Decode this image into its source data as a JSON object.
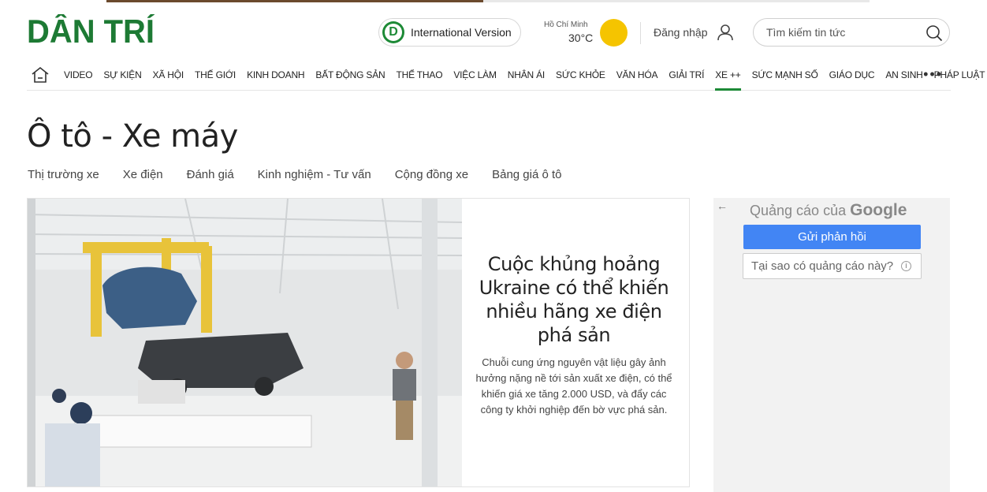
{
  "header": {
    "logo_text": "DÂN TRÍ",
    "international_label": "International Version",
    "weather": {
      "city": "Hồ Chí Minh",
      "temp": "30°C"
    },
    "login_label": "Đăng nhập",
    "search_placeholder": "Tìm kiếm tin tức"
  },
  "colors": {
    "brand_green": "#1d8a36",
    "sun_yellow": "#f5c400",
    "google_blue": "#4285f4"
  },
  "nav": {
    "items": [
      "VIDEO",
      "SỰ KIỆN",
      "XÃ HỘI",
      "THẾ GIỚI",
      "KINH DOANH",
      "BẤT ĐỘNG SẢN",
      "THỂ THAO",
      "VIỆC LÀM",
      "NHÂN ÁI",
      "SỨC KHỎE",
      "VĂN HÓA",
      "GIẢI TRÍ",
      "XE ++",
      "SỨC MẠNH SỐ",
      "GIÁO DỤC",
      "AN SINH",
      "PHÁP LUẬT"
    ],
    "active": "XE ++",
    "more": "•••"
  },
  "page": {
    "title": "Ô tô - Xe máy",
    "subnav": [
      "Thị trường xe",
      "Xe điện",
      "Đánh giá",
      "Kinh nghiệm - Tư vấn",
      "Cộng đồng xe",
      "Bảng giá ô tô"
    ]
  },
  "featured": {
    "headline": "Cuộc khủng hoảng Ukraine có thể khiến nhiều hãng xe điện phá sản",
    "summary": "Chuỗi cung ứng nguyên vật liệu gây ảnh hưởng nặng nề tới sản xuất xe điện, có thể khiến giá xe tăng 2.000 USD, và đẩy các công ty khởi nghiệp đến bờ vực phá sản."
  },
  "ad": {
    "back": "←",
    "label_prefix": "Quảng cáo của",
    "label_brand": "Google",
    "feedback_button": "Gửi phản hồi",
    "why_button": "Tại sao có quảng cáo này?",
    "info": "i"
  }
}
